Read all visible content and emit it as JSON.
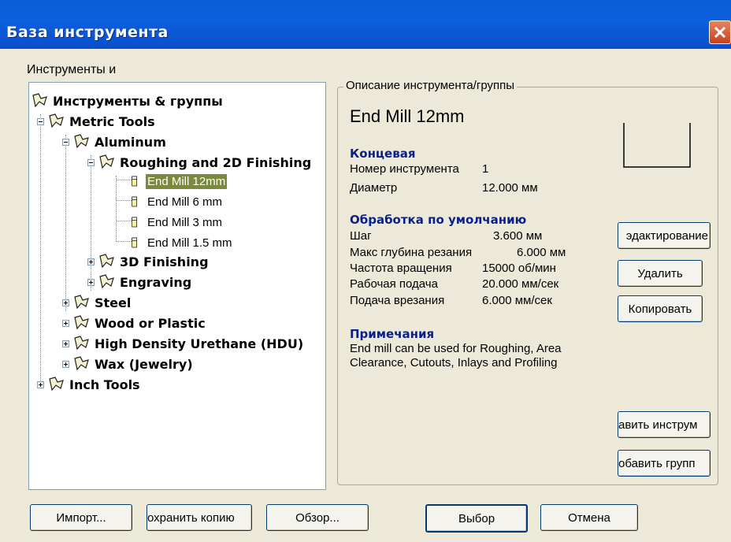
{
  "window": {
    "title": "База инструмента"
  },
  "tree_section_label": "Инструменты и",
  "tree": {
    "root": "Инструменты & группы",
    "metric": "Metric Tools",
    "aluminum": "Aluminum",
    "roughing": "Roughing and 2D Finishing",
    "leaves": [
      "End Mill 12mm",
      "End Mill 6 mm",
      "End Mill 3 mm",
      "End Mill 1.5 mm"
    ],
    "finishing3d": "3D Finishing",
    "engraving": "Engraving",
    "steel": "Steel",
    "wood": "Wood or Plastic",
    "hdu": "High Density Urethane (HDU)",
    "wax": "Wax (Jewelry)",
    "inch": "Inch Tools"
  },
  "details": {
    "legend": "Описание инструмента/группы",
    "tool_name": "End Mill 12mm",
    "type_heading": "Концевая",
    "type_rows": [
      {
        "label": "Номер инструмента",
        "value": "1"
      },
      {
        "label": "Диаметр",
        "value": "12.000 мм"
      }
    ],
    "defaults_heading": "Обработка по умолчанию",
    "default_rows": [
      {
        "label": "Шаг",
        "value": "3.600 мм"
      },
      {
        "label": "Макс глубина резания",
        "value": "6.000 мм"
      },
      {
        "label": "Частота вращения",
        "value": "15000 об/мин"
      },
      {
        "label": "Рабочая подача",
        "value": "20.000 мм/сек"
      },
      {
        "label": "Подача врезания",
        "value": "6.000 мм/сек"
      }
    ],
    "notes_heading": "Примечания",
    "notes_text": "End mill can be used for Roughing, Area Clearance, Cutouts, Inlays and Profiling"
  },
  "side_buttons": {
    "edit": "эдактирование",
    "delete": "Удалить",
    "copy": "Копировать",
    "add_tool": "авить инструм",
    "add_group": "обавить групп"
  },
  "bottom_buttons": {
    "import": "Импорт...",
    "save_copy": "охранить копию",
    "browse": "Обзор...",
    "select": "Выбор",
    "cancel": "Отмена"
  }
}
